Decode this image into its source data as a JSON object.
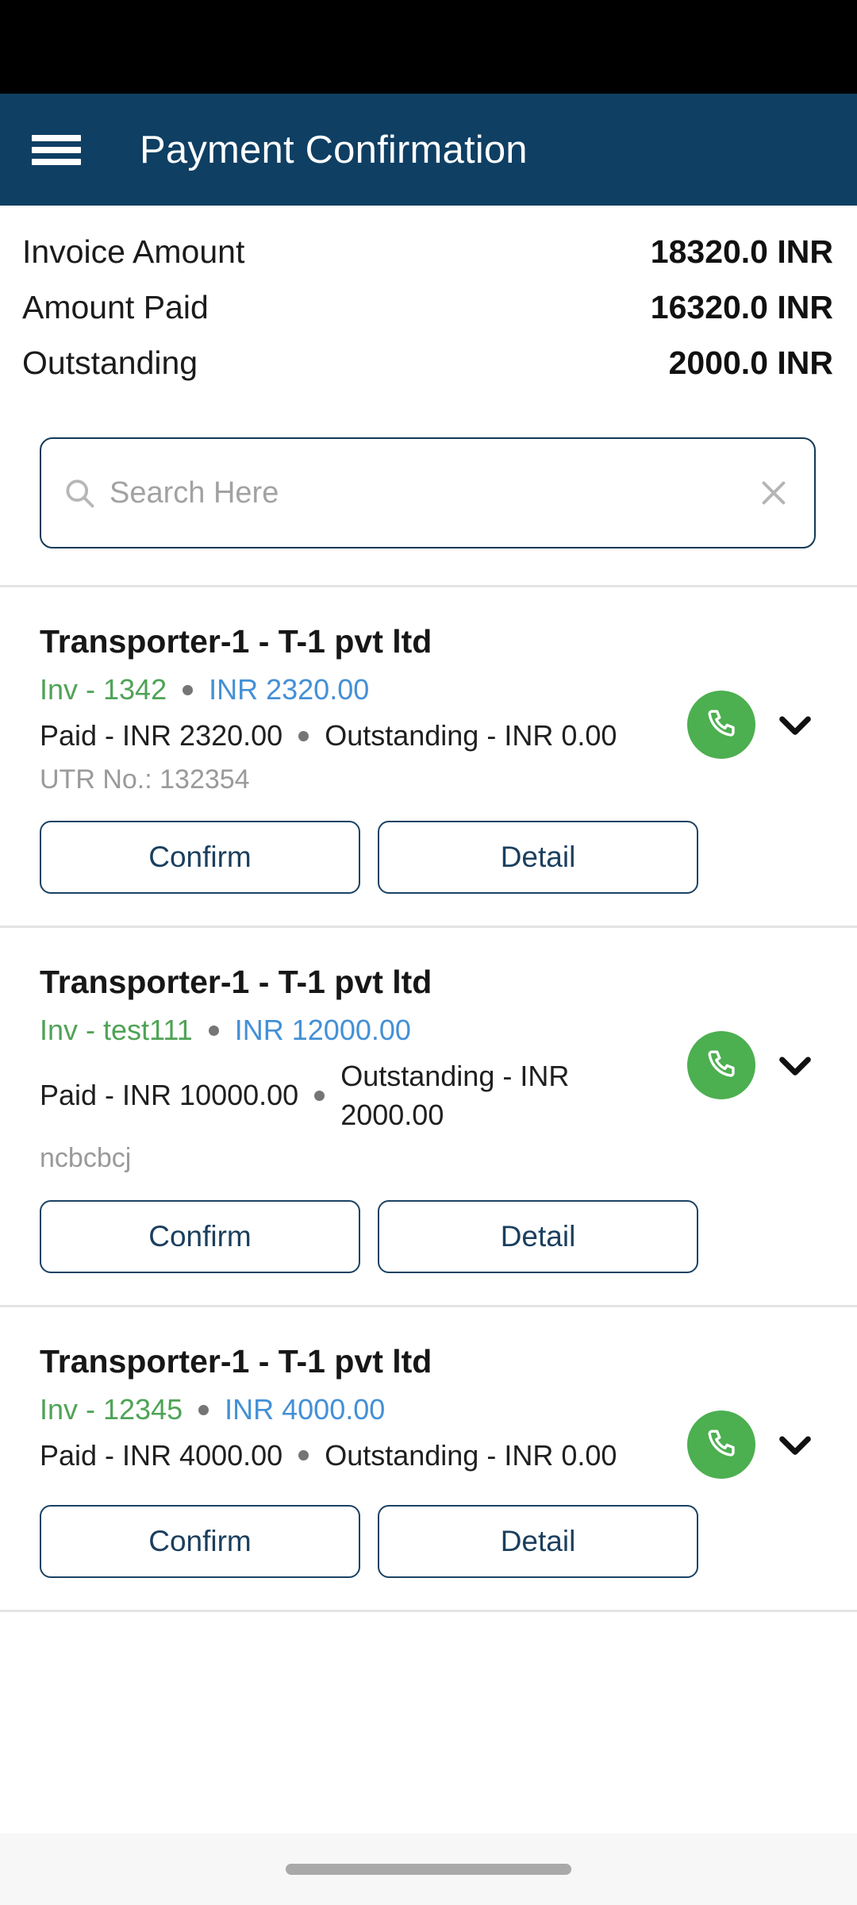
{
  "app_bar": {
    "menu_icon": "hamburger-menu-icon",
    "title": "Payment Confirmation"
  },
  "summary": {
    "rows": [
      {
        "label": "Invoice Amount",
        "value": "18320.0 INR"
      },
      {
        "label": "Amount Paid",
        "value": "16320.0 INR"
      },
      {
        "label": "Outstanding",
        "value": "2000.0 INR"
      }
    ]
  },
  "search": {
    "placeholder": "Search Here",
    "value": "",
    "search_icon": "search-icon",
    "clear_icon": "close-icon"
  },
  "list": {
    "confirm_label": "Confirm",
    "detail_label": "Detail",
    "call_icon": "phone-icon",
    "expand_icon": "chevron-down-icon",
    "items": [
      {
        "title": "Transporter-1 - T-1 pvt ltd",
        "invoice": "Inv - 1342",
        "amount": "INR 2320.00",
        "paid": "Paid - INR 2320.00",
        "outstanding": "Outstanding - INR 0.00",
        "note": "UTR No.: 132354"
      },
      {
        "title": "Transporter-1 - T-1 pvt ltd",
        "invoice": "Inv - test111",
        "amount": "INR 12000.00",
        "paid": "Paid - INR 10000.00",
        "outstanding": "Outstanding - INR 2000.00",
        "note": "ncbcbcj"
      },
      {
        "title": "Transporter-1 - T-1 pvt ltd",
        "invoice": "Inv - 12345",
        "amount": "INR 4000.00",
        "paid": "Paid - INR 4000.00",
        "outstanding": "Outstanding - INR 0.00",
        "note": ""
      }
    ]
  },
  "colors": {
    "header_bg": "#0F3F63",
    "invoice_green": "#4FA356",
    "amount_blue": "#4490D6",
    "call_green": "#4CAF50",
    "button_border": "#1b4263"
  }
}
